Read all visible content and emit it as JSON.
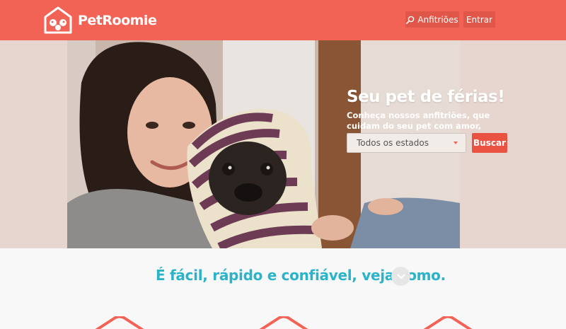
{
  "header": {
    "brand": "PetRoomie",
    "nav": [
      {
        "label": "Anfitriões",
        "icon": "search-icon"
      },
      {
        "label": "Entrar"
      }
    ]
  },
  "hero": {
    "title": "Seu pet de férias!",
    "subtitle": "Conheça nossos anfitriões, que cuidam do seu pet com amor, enquanto você viaja",
    "state_select": {
      "selected": "Todos os estados"
    },
    "search_label": "Buscar"
  },
  "how_it_works": {
    "title": "É fácil, rápido e confiável, veja como.",
    "arrow_icon": "chevron-down-icon"
  },
  "colors": {
    "brand": "#f26355",
    "accent_teal": "#2ab3c9",
    "hero_bg": "#e6d6cf"
  }
}
